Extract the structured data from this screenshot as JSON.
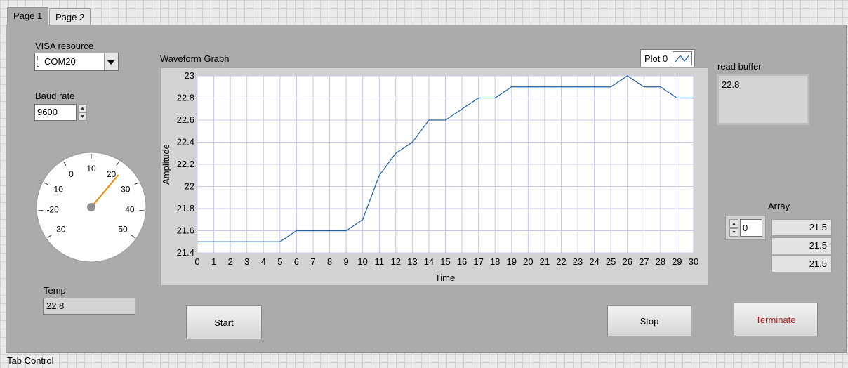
{
  "tabs": [
    {
      "label": "Page 1",
      "active": true
    },
    {
      "label": "Page 2",
      "active": false
    }
  ],
  "tab_control_label": "Tab Control",
  "visa": {
    "label": "VISA resource",
    "value": "COM20",
    "prefix": "I/O"
  },
  "baud": {
    "label": "Baud rate",
    "value": "9600"
  },
  "gauge": {
    "ticks": [
      "-30",
      "-20",
      "-10",
      "0",
      "10",
      "20",
      "30",
      "40",
      "50"
    ],
    "value": 22.8
  },
  "temp": {
    "label": "Temp",
    "value": "22.8"
  },
  "buttons": {
    "start": "Start",
    "stop": "Stop",
    "terminate": "Terminate"
  },
  "read_buffer": {
    "label": "read buffer",
    "value": "22.8"
  },
  "array": {
    "label": "Array",
    "index": "0",
    "values": [
      "21.5",
      "21.5",
      "21.5"
    ]
  },
  "graph": {
    "title": "Waveform Graph",
    "legend": "Plot 0",
    "colors": {
      "line": "#1f5fa8",
      "grid": "#c8c8ea",
      "plot_bg": "#ffffff",
      "frame": "#d3d3d3"
    }
  },
  "chart_data": {
    "type": "line",
    "title": "Waveform Graph",
    "xlabel": "Time",
    "ylabel": "Amplitude",
    "xlim": [
      0,
      30
    ],
    "ylim": [
      21.4,
      23
    ],
    "xticks": [
      "0",
      "1",
      "2",
      "3",
      "4",
      "5",
      "6",
      "7",
      "8",
      "9",
      "10",
      "11",
      "12",
      "13",
      "14",
      "15",
      "16",
      "17",
      "18",
      "19",
      "20",
      "21",
      "22",
      "23",
      "24",
      "25",
      "26",
      "27",
      "28",
      "29",
      "30"
    ],
    "yticks": [
      "21.4",
      "21.6",
      "21.8",
      "22",
      "22.2",
      "22.4",
      "22.6",
      "22.8",
      "23"
    ],
    "grid": true,
    "series": [
      {
        "name": "Plot 0",
        "x": [
          0,
          1,
          2,
          3,
          4,
          5,
          6,
          7,
          8,
          9,
          10,
          11,
          12,
          13,
          14,
          15,
          16,
          17,
          18,
          19,
          20,
          21,
          22,
          23,
          24,
          25,
          26,
          27,
          28,
          29,
          30
        ],
        "values": [
          21.5,
          21.5,
          21.5,
          21.5,
          21.5,
          21.5,
          21.6,
          21.6,
          21.6,
          21.6,
          21.7,
          22.1,
          22.3,
          22.4,
          22.6,
          22.6,
          22.7,
          22.8,
          22.8,
          22.9,
          22.9,
          22.9,
          22.9,
          22.9,
          22.9,
          22.9,
          23.0,
          22.9,
          22.9,
          22.8,
          22.8
        ]
      }
    ]
  }
}
